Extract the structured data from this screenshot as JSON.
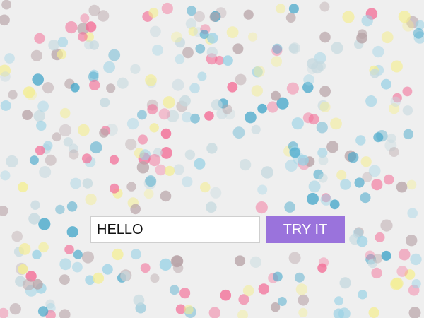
{
  "background": {
    "color": "#efefef",
    "confetti_colors": [
      "#41a5c9",
      "#f36b95",
      "#b8a4a8",
      "#f4ee92",
      "#9bd2e5",
      "#c5d9df"
    ]
  },
  "form": {
    "input_value": "HELLO",
    "input_placeholder": "",
    "button_label": "TRY IT",
    "button_color": "#9a73dc",
    "input_border_color": "#cfcfcf"
  }
}
